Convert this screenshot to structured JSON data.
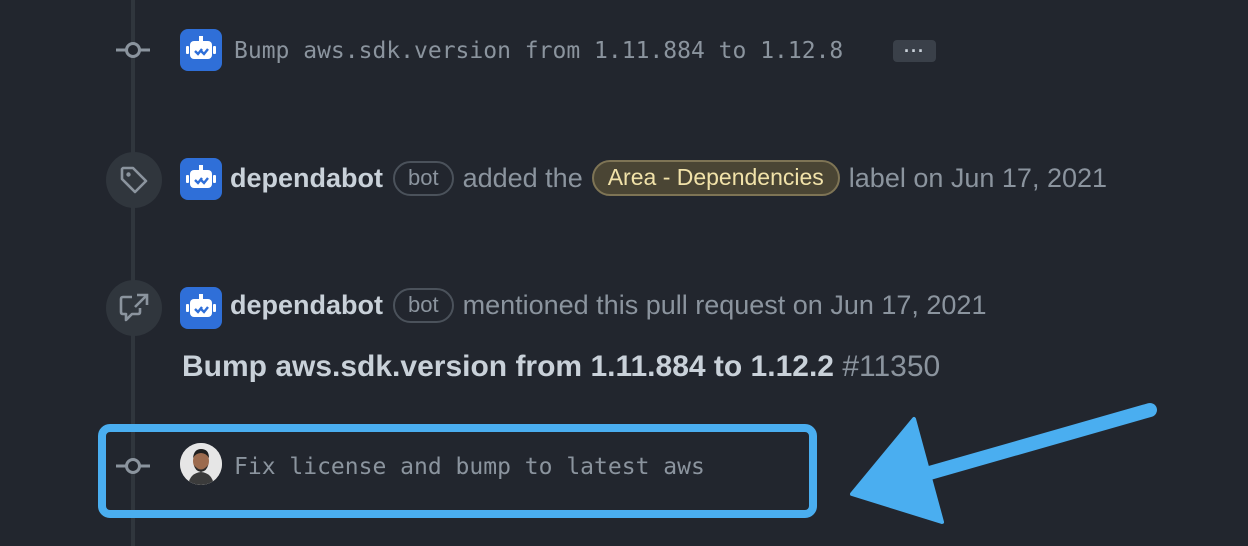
{
  "timeline": {
    "commit1": {
      "message": "Bump aws.sdk.version from 1.11.884 to 1.12.8",
      "more_label": "···",
      "avatar_icon": "dependabot-icon"
    },
    "label_event": {
      "author": "dependabot",
      "badge": "bot",
      "action": "added the",
      "label": "Area - Dependencies",
      "suffix": "label on Jun 17, 2021",
      "icon": "tag-icon"
    },
    "mention_event": {
      "author": "dependabot",
      "badge": "bot",
      "action": "mentioned this pull request on Jun 17, 2021",
      "icon": "cross-reference-icon",
      "ref_title": "Bump aws.sdk.version from 1.11.884 to 1.12.2",
      "ref_number": "#11350"
    },
    "commit2": {
      "message": "Fix license and bump to latest aws",
      "avatar_icon": "user-avatar"
    }
  },
  "colors": {
    "background": "#22262e",
    "highlight": "#4aaef0",
    "bot_avatar": "#2f6fd8",
    "label_text": "#f1e2a9"
  }
}
